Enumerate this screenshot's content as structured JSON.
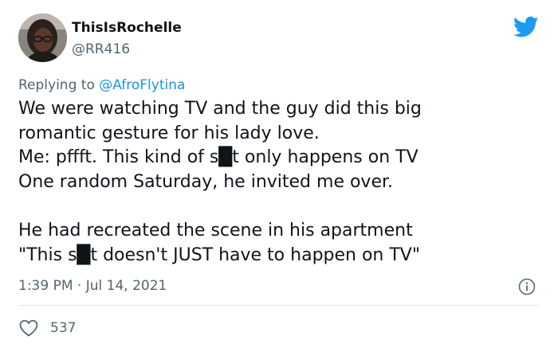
{
  "author": {
    "display_name": "ThisIsRochelle",
    "handle": "@RR416",
    "avatar_icon": "profile-photo"
  },
  "reply": {
    "prefix": "Replying to ",
    "mention": "@AfroFlytina"
  },
  "tweet": {
    "text": "We were watching TV and the guy did this big\nromantic gesture for his lady love.\nMe: pffft. This kind of s█t only happens on TV\nOne random Saturday, he invited me over.\n\nHe had recreated the scene in his apartment\n\"This s█t doesn't JUST have to happen on TV\"",
    "timestamp": "1:39 PM · Jul 14, 2021",
    "likes": "537"
  },
  "icons": {
    "brand": "twitter-bird-icon",
    "info": "info-icon",
    "like": "heart-icon"
  },
  "colors": {
    "brand_blue": "#1d9bf0",
    "mention_blue": "#1b95e0",
    "secondary_text": "#536471",
    "primary_text": "#0f1419",
    "divider": "#dfe5e8"
  }
}
